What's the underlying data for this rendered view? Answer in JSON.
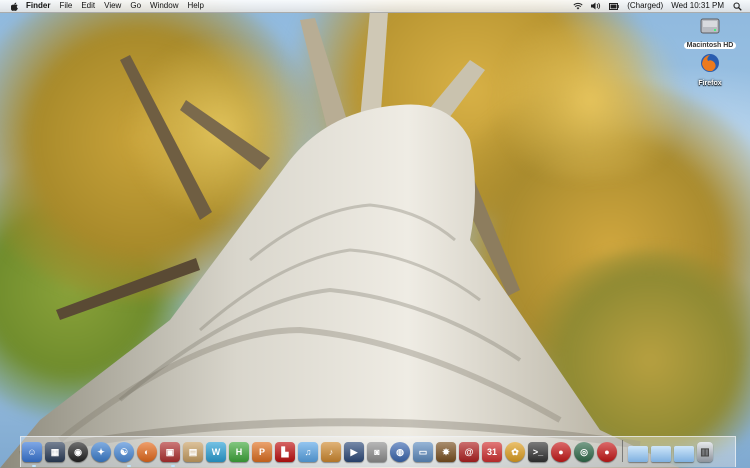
{
  "menubar": {
    "app_name": "Finder",
    "items": [
      "File",
      "Edit",
      "View",
      "Go",
      "Window",
      "Help"
    ],
    "battery_status": "(Charged)",
    "clock": "Wed 10:31 PM"
  },
  "desktop": {
    "icons": [
      {
        "name": "harddisk",
        "label": "Macintosh HD"
      },
      {
        "name": "firefox",
        "label": "Firefox"
      }
    ]
  },
  "dock": {
    "apps": [
      {
        "icon": "finder-icon",
        "color": "#3a78d8",
        "glyph": "☺"
      },
      {
        "icon": "dashboard-icon",
        "color": "#2b3d59",
        "glyph": "▦"
      },
      {
        "icon": "dvd-icon",
        "color": "#222222",
        "glyph": "◉"
      },
      {
        "icon": "safari-icon",
        "color": "#3c7fd0",
        "glyph": "✦"
      },
      {
        "icon": "finder-search-icon",
        "color": "#4a8ad8",
        "glyph": "☯"
      },
      {
        "icon": "firefox-icon",
        "color": "#e66a1c",
        "glyph": "◐"
      },
      {
        "icon": "photo-booth-icon",
        "color": "#b03030",
        "glyph": "▣"
      },
      {
        "icon": "scroll-icon",
        "color": "#c9a063",
        "glyph": "▤"
      },
      {
        "icon": "word-icon",
        "color": "#2aa0d6",
        "glyph": "W"
      },
      {
        "icon": "h-app-icon",
        "color": "#3fa83b",
        "glyph": "H"
      },
      {
        "icon": "powerpoint-icon",
        "color": "#e07020",
        "glyph": "P"
      },
      {
        "icon": "chair-icon",
        "color": "#c01010",
        "glyph": "▙"
      },
      {
        "icon": "itunes-icon",
        "color": "#5aa6e8",
        "glyph": "♫"
      },
      {
        "icon": "garageband-icon",
        "color": "#d08a30",
        "glyph": "♪"
      },
      {
        "icon": "imovie-icon",
        "color": "#2d4a7a",
        "glyph": "▶"
      },
      {
        "icon": "camera-icon",
        "color": "#909090",
        "glyph": "◙"
      },
      {
        "icon": "network-globe-icon",
        "color": "#3a66b0",
        "glyph": "◍"
      },
      {
        "icon": "display-icon",
        "color": "#5e8cc0",
        "glyph": "▭"
      },
      {
        "icon": "game-icon",
        "color": "#7a5020",
        "glyph": "✸"
      },
      {
        "icon": "address-book-icon",
        "color": "#b02020",
        "glyph": "@"
      },
      {
        "icon": "ical-icon",
        "color": "#d23030",
        "glyph": "31"
      },
      {
        "icon": "pinwheel-icon",
        "color": "#e0a020",
        "glyph": "✿"
      },
      {
        "icon": "terminal-icon",
        "color": "#333333",
        "glyph": ">_"
      },
      {
        "icon": "lock-icon",
        "color": "#c81818",
        "glyph": "●"
      },
      {
        "icon": "compass-icon",
        "color": "#2f6a4a",
        "glyph": "◎"
      },
      {
        "icon": "lock-red-icon",
        "color": "#c81818",
        "glyph": "●"
      }
    ],
    "stacks": [
      {
        "icon": "folder-icon",
        "color": "#7fb0e0"
      },
      {
        "icon": "folder-icon",
        "color": "#7fb0e0"
      },
      {
        "icon": "folder-icon",
        "color": "#7fb0e0"
      }
    ]
  }
}
